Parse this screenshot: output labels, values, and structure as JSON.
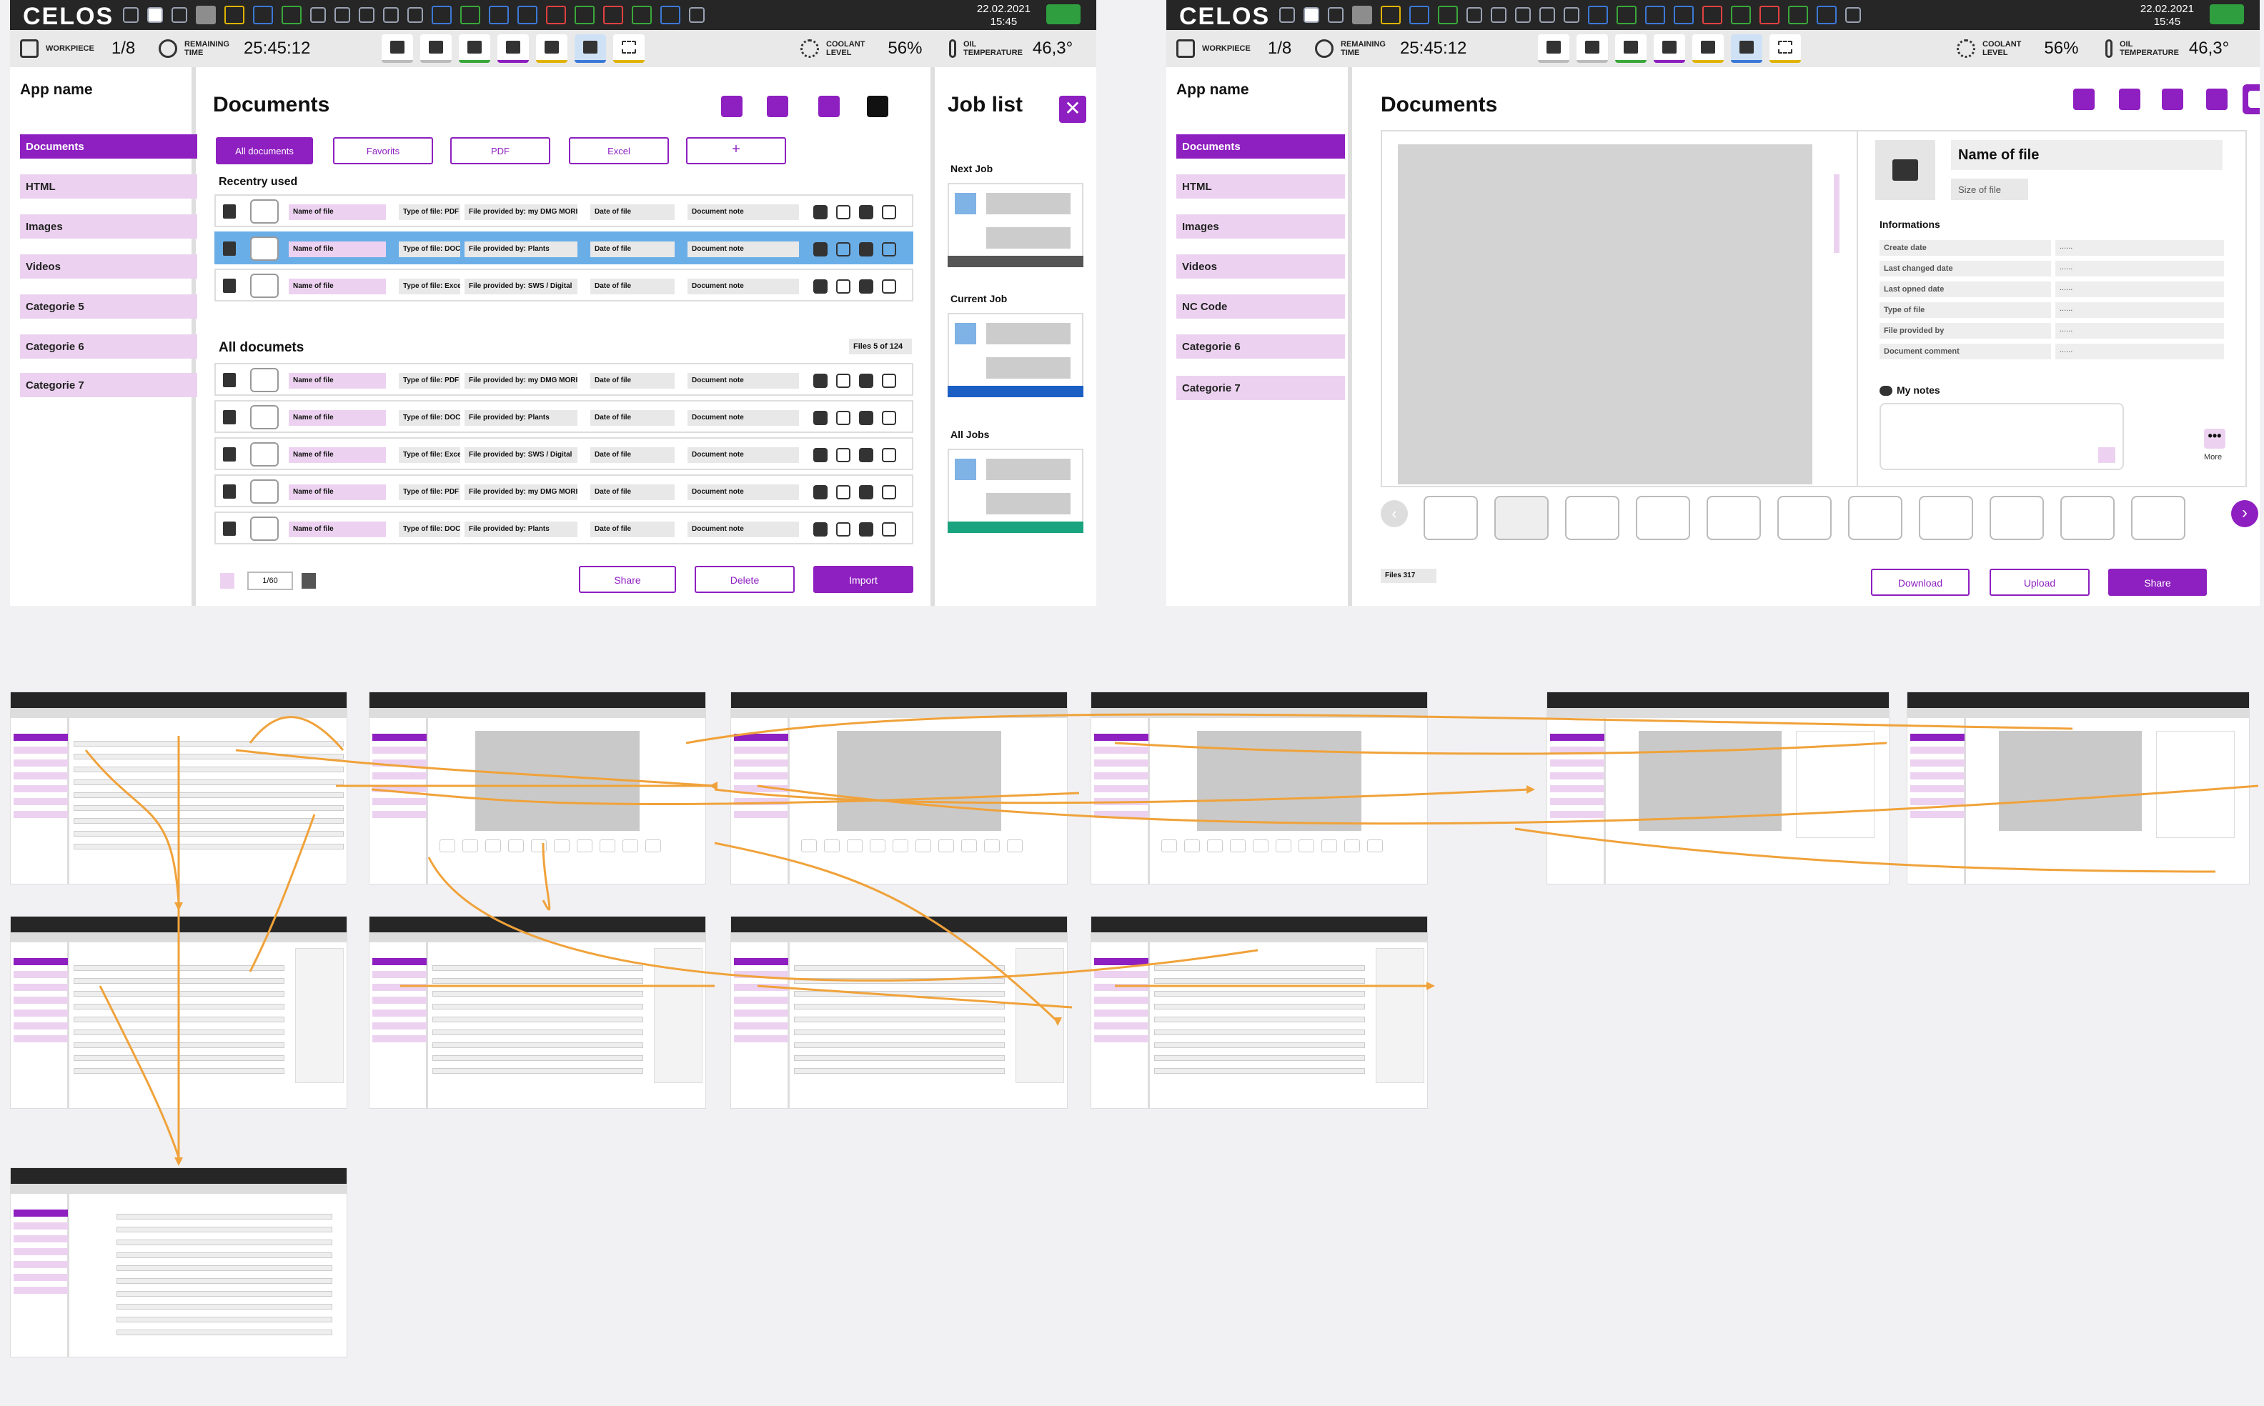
{
  "topbar": {
    "logo": "CELOS",
    "date": "22.02.2021",
    "time": "15:45",
    "workpiece_label": "WORKPIECE",
    "workpiece_value": "1/8",
    "remaining_label_1": "REMAINING",
    "remaining_label_2": "TIME",
    "remaining_value": "25:45:12",
    "coolant_label_1": "COOLANT",
    "coolant_label_2": "LEVEL",
    "coolant_value": "56%",
    "oil_label_1": "OIL",
    "oil_label_2": "TEMPERATURE",
    "oil_value": "46,3°",
    "status_icons": [
      "window-icon",
      "window-icon",
      "window-icon",
      "machine-icon",
      "atc-icon",
      "tool-icon",
      "gear-icon",
      "us-icon",
      "conveyor-icon",
      "coolant-icon",
      "spindle-icon",
      "sensor-icon",
      "pen-icon",
      "clock-icon",
      "sync-icon",
      "alarm-icon",
      "pencil-icon",
      "settings-icon",
      "plug-icon",
      "cloud-icon"
    ]
  },
  "left_screen": {
    "app_name": "App name",
    "sidebar_items": [
      "Documents",
      "HTML",
      "Images",
      "Videos",
      "Categorie 5",
      "Categorie 6",
      "Categorie 7"
    ],
    "title": "Documents",
    "filter_chips": [
      "All documents",
      "Favorits",
      "PDF",
      "Excel",
      "+"
    ],
    "recent_title": "Recentry used",
    "recent_rows": [
      {
        "name": "Name of file",
        "type": "Type of file: PDF",
        "provider": "File provided by: my DMG MORI",
        "date": "Date of file",
        "note": "Document note"
      },
      {
        "name": "Name of file",
        "type": "Type of file: DOC",
        "provider": "File provided by: Plants",
        "date": "Date of file",
        "note": "Document note"
      },
      {
        "name": "Name of file",
        "type": "Type of file: Excel",
        "provider": "File provided by: SWS / Digital",
        "date": "Date of file",
        "note": "Document note"
      }
    ],
    "all_title": "All documets",
    "files_count": "Files 5 of 124",
    "all_rows": [
      {
        "name": "Name of file",
        "type": "Type of file: PDF",
        "provider": "File provided by: my DMG MORI",
        "date": "Date of file",
        "note": "Document note"
      },
      {
        "name": "Name of file",
        "type": "Type of file: DOC",
        "provider": "File provided by: Plants",
        "date": "Date of file",
        "note": "Document note"
      },
      {
        "name": "Name of file",
        "type": "Type of file: Excel",
        "provider": "File provided by: SWS / Digital",
        "date": "Date of file",
        "note": "Document note"
      },
      {
        "name": "Name of file",
        "type": "Type of file: PDF",
        "provider": "File provided by: my DMG MORI",
        "date": "Date of file",
        "note": "Document note"
      },
      {
        "name": "Name of file",
        "type": "Type of file: DOC",
        "provider": "File provided by: Plants",
        "date": "Date of file",
        "note": "Document note"
      }
    ],
    "pagination": "1/60",
    "buttons": {
      "share": "Share",
      "delete": "Delete",
      "import": "Import"
    },
    "job_list": {
      "title": "Job list",
      "next": "Next Job",
      "current": "Current Job",
      "all": "All Jobs",
      "colors": {
        "next": "#555555",
        "current": "#1b5fc4",
        "all": "#19a37f"
      }
    }
  },
  "right_screen": {
    "app_name": "App name",
    "sidebar_items": [
      "Documents",
      "HTML",
      "Images",
      "Videos",
      "NC Code",
      "Categorie 6",
      "Categorie 7"
    ],
    "title": "Documents",
    "file_name": "Name of file",
    "file_size": "Size of file",
    "info_title": "Informations",
    "info_rows": [
      {
        "label": "Create date",
        "value": "......"
      },
      {
        "label": "Last changed date",
        "value": "......"
      },
      {
        "label": "Last opned date",
        "value": "......"
      },
      {
        "label": "Type of file",
        "value": "......"
      },
      {
        "label": "File provided by",
        "value": "......"
      },
      {
        "label": "Document comment",
        "value": "......"
      }
    ],
    "notes_title": "My notes",
    "more_label": "More",
    "files_label": "Files 317",
    "buttons": {
      "download": "Download",
      "upload": "Upload",
      "share": "Share"
    }
  },
  "colors": {
    "accent": "#8e1fc0",
    "accent_light": "#ecd2f0",
    "highlight_row": "#6aaee8",
    "flow_arrow": "#f0a23a"
  }
}
